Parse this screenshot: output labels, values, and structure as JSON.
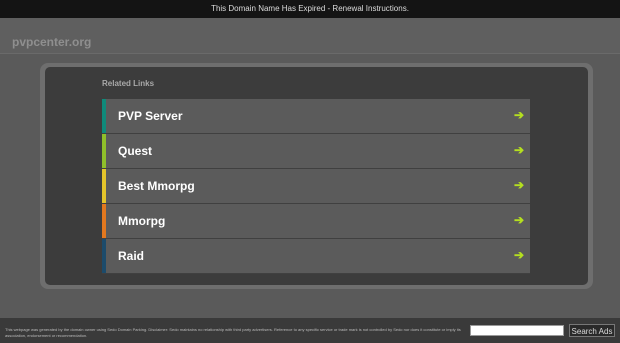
{
  "topbar": {
    "notice": "This Domain Name Has Expired - Renewal Instructions."
  },
  "header": {
    "domain": "pvpcenter.org"
  },
  "main": {
    "title": "Related Links",
    "links": [
      {
        "label": "PVP Server",
        "accent": "#0f8a7a"
      },
      {
        "label": "Quest",
        "accent": "#8fbf2a"
      },
      {
        "label": "Best Mmorpg",
        "accent": "#e5c52b"
      },
      {
        "label": "Mmorpg",
        "accent": "#e2781f"
      },
      {
        "label": "Raid",
        "accent": "#1c4b6b"
      }
    ],
    "arrow_icon": "arrow-right-icon",
    "arrow_glyph": "➔",
    "arrow_color": "#b5e01f"
  },
  "footer": {
    "disclaimer": "This webpage was generated by the domain owner using Sedo Domain Parking. Disclaimer: Sedo maintains no relationship with third party advertisers. Reference to any specific service or trade mark is not controlled by Sedo nor does it constitute or imply its association, endorsement or recommendation.",
    "search_value": "",
    "search_button": "Search Ads"
  }
}
